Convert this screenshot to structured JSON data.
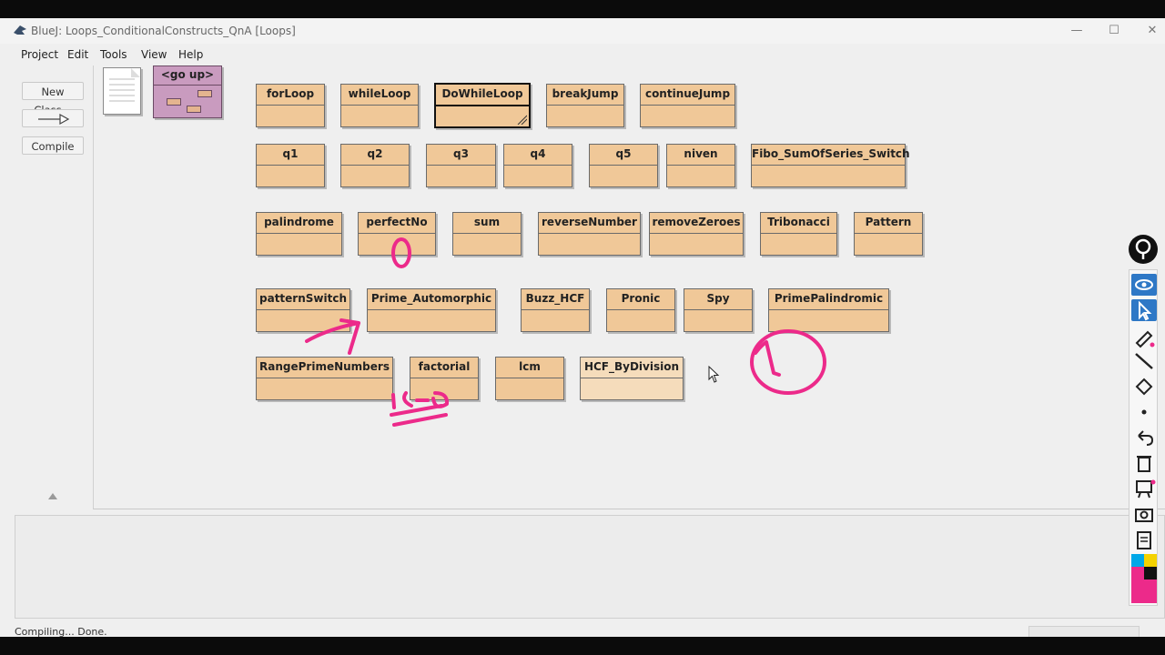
{
  "window": {
    "title": "BlueJ:  Loops_ConditionalConstructs_QnA  [Loops]",
    "controls": {
      "minimize": "—",
      "maximize": "☐",
      "close": "✕"
    }
  },
  "menu": [
    "Project",
    "Edit",
    "Tools",
    "View",
    "Help"
  ],
  "side_tools": {
    "new_class": "New Class...",
    "compile": "Compile"
  },
  "go_up": {
    "label": "<go up>"
  },
  "classes": [
    {
      "name": "forLoop"
    },
    {
      "name": "whileLoop"
    },
    {
      "name": "DoWhileLoop"
    },
    {
      "name": "breakJump"
    },
    {
      "name": "continueJump"
    },
    {
      "name": "q1"
    },
    {
      "name": "q2"
    },
    {
      "name": "q3"
    },
    {
      "name": "q4"
    },
    {
      "name": "q5"
    },
    {
      "name": "niven"
    },
    {
      "name": "Fibo_SumOfSeries_Switch"
    },
    {
      "name": "palindrome"
    },
    {
      "name": "perfectNo"
    },
    {
      "name": "sum"
    },
    {
      "name": "reverseNumber"
    },
    {
      "name": "removeZeroes"
    },
    {
      "name": "Tribonacci"
    },
    {
      "name": "Pattern"
    },
    {
      "name": "patternSwitch"
    },
    {
      "name": "Prime_Automorphic"
    },
    {
      "name": "Buzz_HCF"
    },
    {
      "name": "Pronic"
    },
    {
      "name": "Spy"
    },
    {
      "name": "PrimePalindromic"
    },
    {
      "name": "RangePrimeNumbers"
    },
    {
      "name": "factorial"
    },
    {
      "name": "lcm"
    },
    {
      "name": "HCF_ByDivision"
    }
  ],
  "status": {
    "text": "Compiling... Done."
  },
  "annotation_color": "#ec2a8a",
  "annotation_tools": [
    "pin-icon",
    "eye-icon",
    "pointer-icon",
    "pen-icon",
    "line-icon",
    "eraser-icon",
    "dot-icon",
    "undo-icon",
    "trash-icon",
    "whiteboard-icon",
    "camera-icon",
    "clipboard-icon",
    "color-palette"
  ]
}
